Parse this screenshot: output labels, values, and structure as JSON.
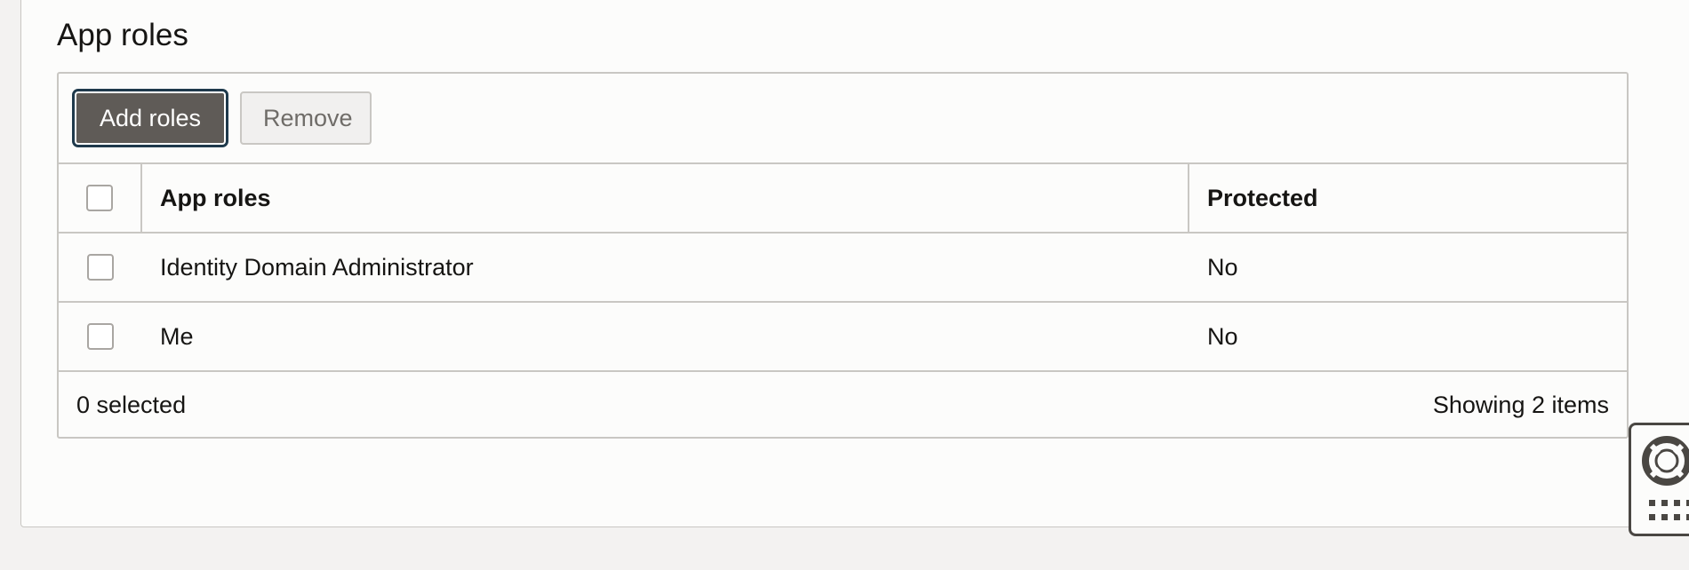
{
  "section": {
    "title": "App roles"
  },
  "toolbar": {
    "add_label": "Add roles",
    "remove_label": "Remove"
  },
  "table": {
    "columns": [
      "App roles",
      "Protected"
    ],
    "rows": [
      {
        "role": "Identity Domain Administrator",
        "protected": "No"
      },
      {
        "role": "Me",
        "protected": "No"
      }
    ]
  },
  "footer": {
    "selected_text": "0 selected",
    "showing_text": "Showing 2 items"
  },
  "help_widget": {
    "icons": [
      "lifebuoy-icon",
      "grid-icon"
    ]
  }
}
